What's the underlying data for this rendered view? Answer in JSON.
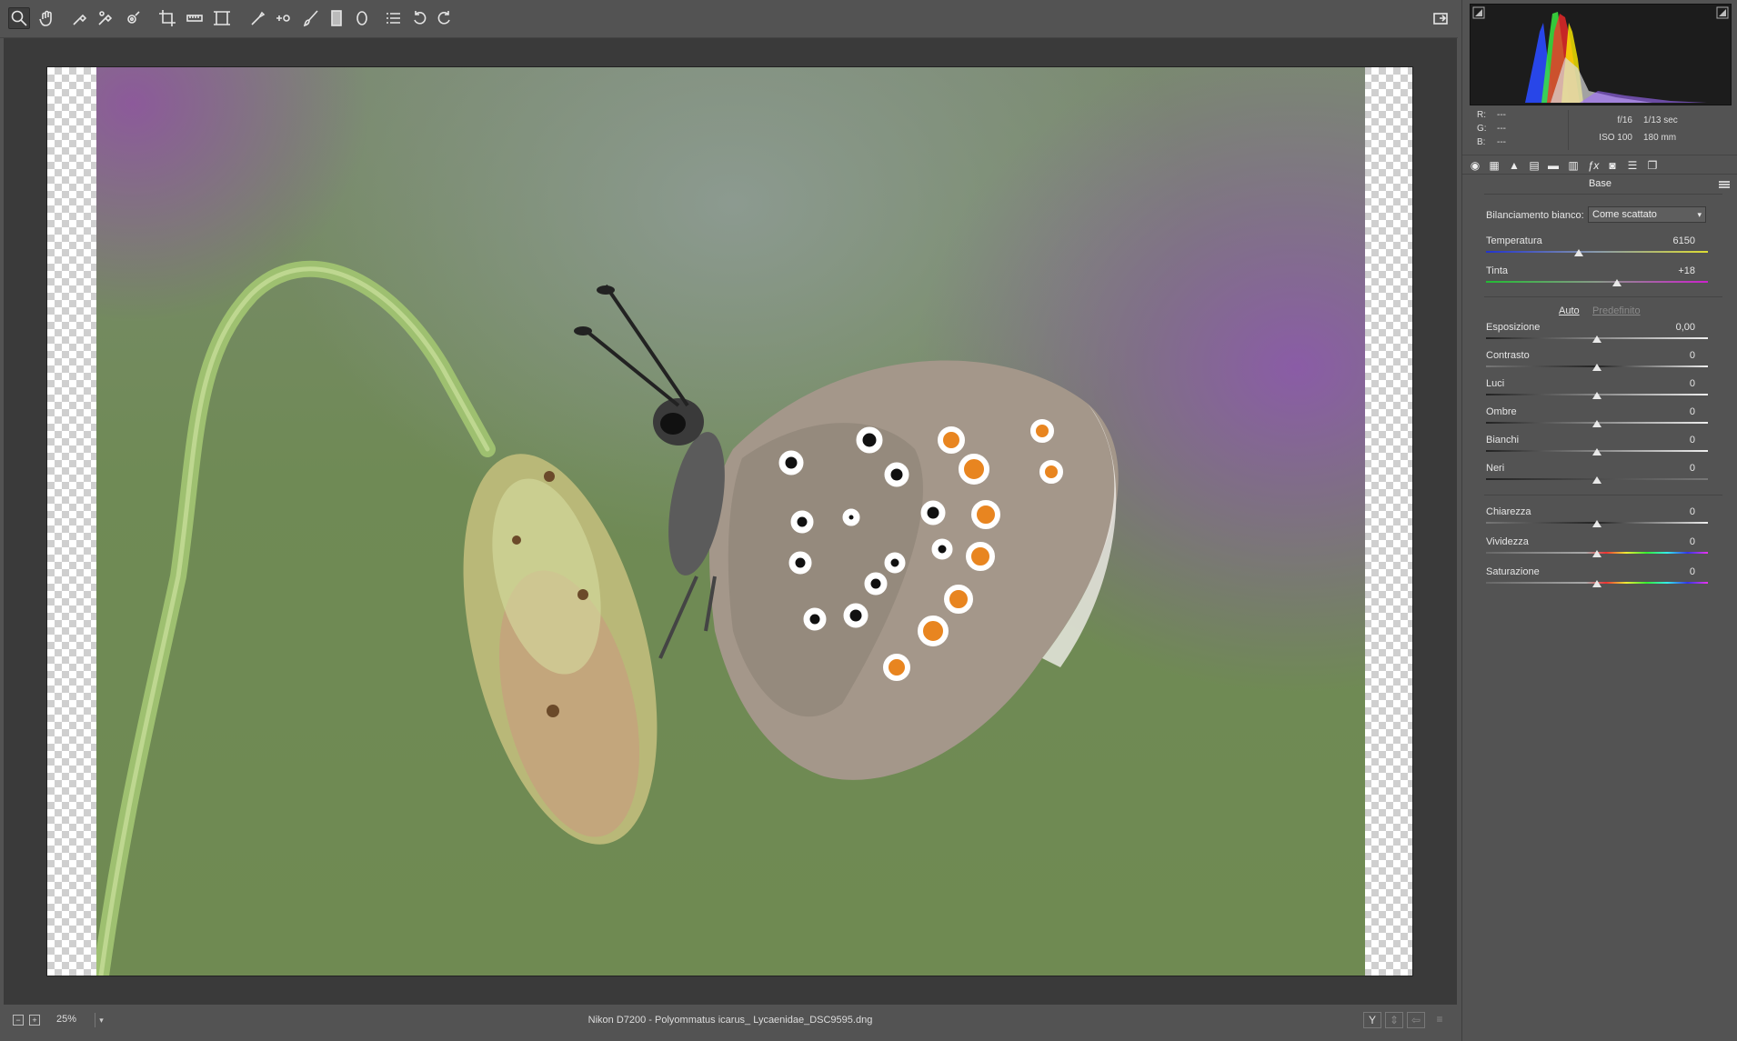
{
  "toolbar": {
    "tools": [
      "zoom-tool",
      "hand-tool",
      "white-balance-tool",
      "color-sampler-tool",
      "targeted-adjustment-tool",
      "crop-tool",
      "straighten-tool",
      "transform-tool",
      "spot-removal-tool",
      "red-eye-tool",
      "adjustment-brush-tool",
      "graduated-filter-tool",
      "radial-filter-tool",
      "preferences-tool",
      "rotate-left-tool",
      "rotate-right-tool"
    ],
    "fullscreen_icon": "fullscreen-toggle-icon"
  },
  "status": {
    "zoom": "25%",
    "file_label": "Nikon D7200  -  Polyommatus icarus_ Lycaenidae_DSC9595.dng"
  },
  "readout": {
    "r_label": "R:",
    "g_label": "G:",
    "b_label": "B:",
    "r": "---",
    "g": "---",
    "b": "---",
    "aperture": "f/16",
    "shutter": "1/13 sec",
    "iso": "ISO 100",
    "focal": "180 mm"
  },
  "panel": {
    "section_title": "Base",
    "wb_label": "Bilanciamento bianco:",
    "wb_value": "Come scattato",
    "auto": "Auto",
    "default": "Predefinito",
    "sliders": {
      "temperatura": {
        "label": "Temperatura",
        "value": "6150",
        "level": 0.42
      },
      "tinta": {
        "label": "Tinta",
        "value": "+18",
        "level": 0.59
      },
      "esposizione": {
        "label": "Esposizione",
        "value": "0,00",
        "level": 0.5
      },
      "contrasto": {
        "label": "Contrasto",
        "value": "0",
        "level": 0.5
      },
      "luci": {
        "label": "Luci",
        "value": "0",
        "level": 0.5
      },
      "ombre": {
        "label": "Ombre",
        "value": "0",
        "level": 0.5
      },
      "bianchi": {
        "label": "Bianchi",
        "value": "0",
        "level": 0.5
      },
      "neri": {
        "label": "Neri",
        "value": "0",
        "level": 0.5
      },
      "chiarezza": {
        "label": "Chiarezza",
        "value": "0",
        "level": 0.5
      },
      "vividezza": {
        "label": "Vividezza",
        "value": "0",
        "level": 0.5
      },
      "saturazione": {
        "label": "Saturazione",
        "value": "0",
        "level": 0.5
      }
    }
  },
  "colors": {
    "accent_panel": "#535353",
    "viewer_bg": "#3a3a3a"
  }
}
